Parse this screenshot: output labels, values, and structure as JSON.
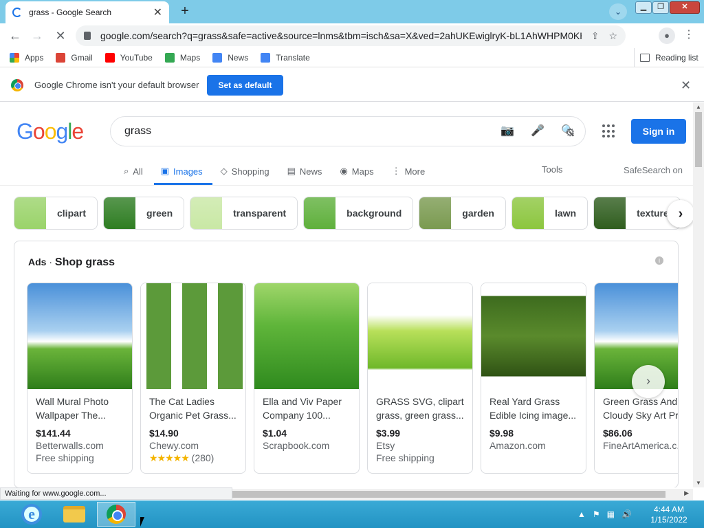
{
  "browser": {
    "tab_title": "grass - Google Search",
    "new_tab": "+",
    "url": "google.com/search?q=grass&safe=active&source=lnms&tbm=isch&sa=X&ved=2ahUKEwiglryK-bL1AhWHPM0KHbE...",
    "bookmarks": [
      {
        "label": "Apps",
        "icon": "apps-grid-icon"
      },
      {
        "label": "Gmail",
        "icon": "gmail-icon",
        "color": "#db4437"
      },
      {
        "label": "YouTube",
        "icon": "youtube-icon",
        "color": "#ff0000"
      },
      {
        "label": "Maps",
        "icon": "maps-icon",
        "color": "#34a853"
      },
      {
        "label": "News",
        "icon": "news-icon",
        "color": "#4285f4"
      },
      {
        "label": "Translate",
        "icon": "translate-icon",
        "color": "#4285f4"
      }
    ],
    "reading_list": "Reading list",
    "infobar_text": "Google Chrome isn't your default browser",
    "set_default": "Set as default",
    "status": "Waiting for www.google.com..."
  },
  "google": {
    "logo": [
      "G",
      "o",
      "o",
      "g",
      "l",
      "e"
    ],
    "logo_colors": [
      "#4285f4",
      "#ea4335",
      "#fbbc05",
      "#4285f4",
      "#34a853",
      "#ea4335"
    ],
    "query": "grass",
    "sign_in": "Sign in",
    "tabs": [
      {
        "label": "All",
        "icon": "search-icon"
      },
      {
        "label": "Images",
        "icon": "image-icon"
      },
      {
        "label": "Shopping",
        "icon": "tag-icon"
      },
      {
        "label": "News",
        "icon": "news-icon"
      },
      {
        "label": "Maps",
        "icon": "map-pin-icon"
      },
      {
        "label": "More",
        "icon": "more-vert-icon"
      }
    ],
    "tools": "Tools",
    "safesearch": "SafeSearch on",
    "chips": [
      {
        "label": "clipart",
        "color": "#9ad36a"
      },
      {
        "label": "green",
        "color": "#2e7d22"
      },
      {
        "label": "transparent",
        "color": "#c9e8a5"
      },
      {
        "label": "background",
        "color": "#5fb03c"
      },
      {
        "label": "garden",
        "color": "#7a9a50"
      },
      {
        "label": "lawn",
        "color": "#8cc63f"
      },
      {
        "label": "texture",
        "color": "#2f5d1e"
      }
    ],
    "ads": {
      "prefix": "Ads",
      "title": "Shop grass",
      "products": [
        {
          "title": "Wall Mural Photo Wallpaper The...",
          "price": "$141.44",
          "store": "Betterwalls.com",
          "extra": "Free shipping",
          "img": "sky-grass"
        },
        {
          "title": "The Cat Ladies Organic Pet Grass...",
          "price": "$14.90",
          "store": "Chewy.com",
          "extra": "★★★★★ (280)",
          "img": "pots"
        },
        {
          "title": "Ella and Viv Paper Company 100...",
          "price": "$1.04",
          "store": "Scrapbook.com",
          "extra": "",
          "img": "field"
        },
        {
          "title": "GRASS SVG, clipart grass, green grass...",
          "price": "$3.99",
          "store": "Etsy",
          "extra": "Free shipping",
          "img": "clip"
        },
        {
          "title": "Real Yard Grass Edible Icing image...",
          "price": "$9.98",
          "store": "Amazon.com",
          "extra": "",
          "img": "dark"
        },
        {
          "title": "Green Grass And Cloudy Sky Art Pr...",
          "price": "$86.06",
          "store": "FineArtAmerica.c...",
          "extra": "",
          "img": "sky-grass"
        }
      ]
    }
  },
  "taskbar": {
    "time": "4:44 AM",
    "date": "1/15/2022"
  }
}
